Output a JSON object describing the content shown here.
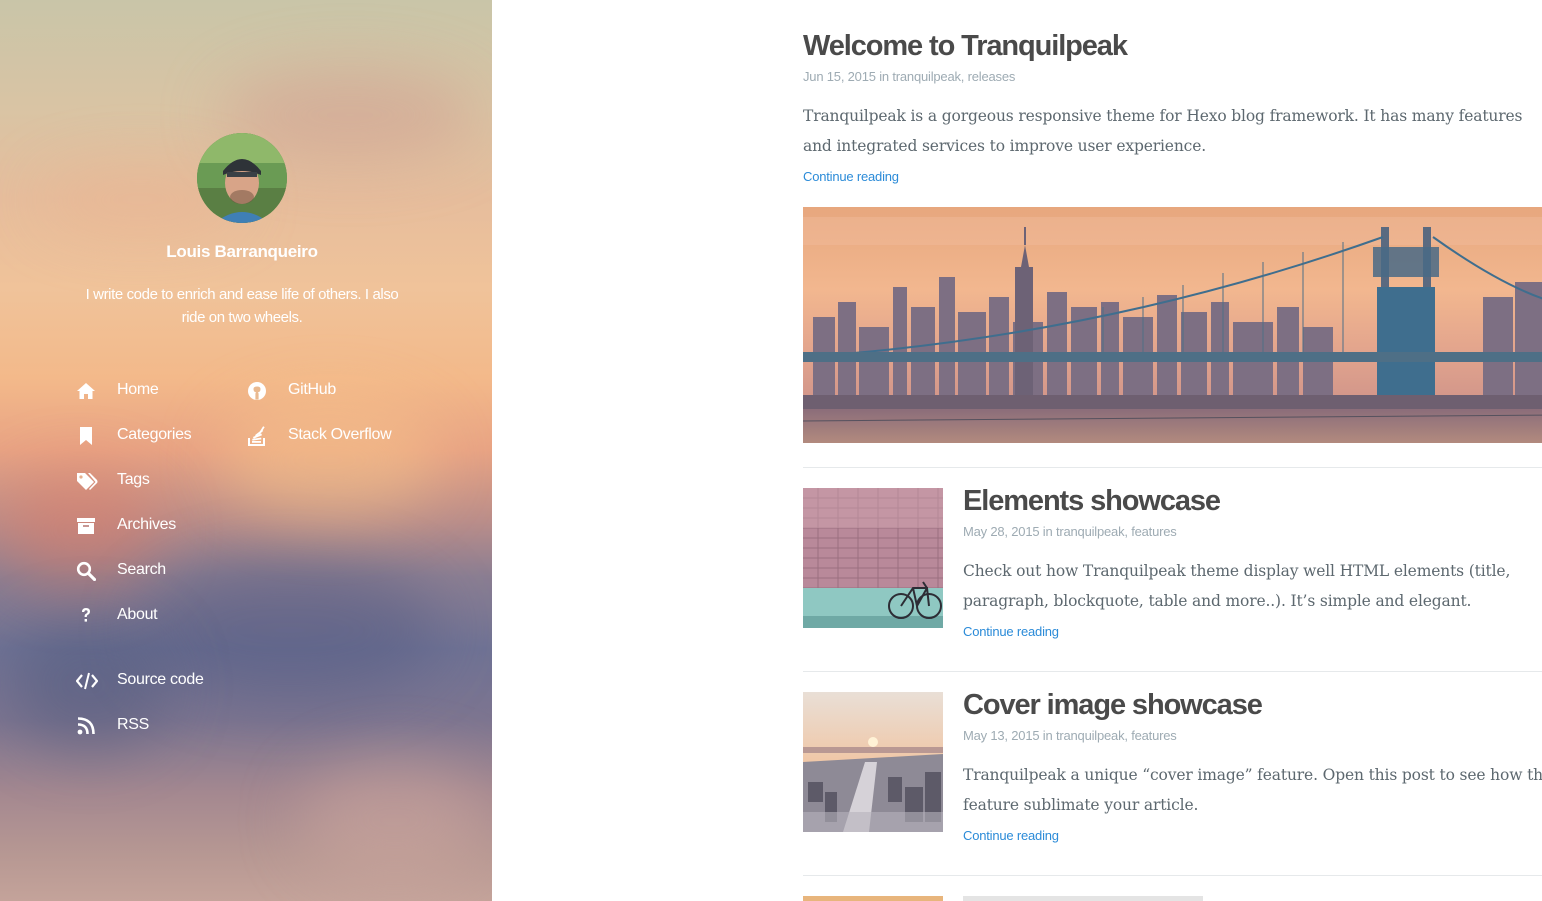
{
  "sidebar": {
    "profile": {
      "name": "Louis Barranqueiro",
      "bio": "I write code to enrich and ease life of others. I also ride on two wheels."
    },
    "menu": [
      {
        "label": "Home",
        "icon": "home-icon"
      },
      {
        "label": "Categories",
        "icon": "bookmark-icon"
      },
      {
        "label": "Tags",
        "icon": "tags-icon"
      },
      {
        "label": "Archives",
        "icon": "archive-icon"
      },
      {
        "label": "Search",
        "icon": "search-icon"
      },
      {
        "label": "About",
        "icon": "question-icon"
      }
    ],
    "social": [
      {
        "label": "GitHub",
        "icon": "github-icon"
      },
      {
        "label": "Stack Overflow",
        "icon": "stack-overflow-icon"
      }
    ],
    "links": [
      {
        "label": "Source code",
        "icon": "code-icon"
      },
      {
        "label": "RSS",
        "icon": "rss-icon"
      }
    ]
  },
  "posts": [
    {
      "title": "Welcome to Tranquilpeak",
      "date": "Jun 15, 2015",
      "in": "in",
      "categories": [
        "tranquilpeak",
        "releases"
      ],
      "excerpt": "Tranquilpeak is a gorgeous responsive theme for Hexo blog framework. It has many features and integrated services to improve user experience.",
      "continue": "Continue reading"
    },
    {
      "title": "Elements showcase",
      "date": "May 28, 2015",
      "in": "in",
      "categories": [
        "tranquilpeak",
        "features"
      ],
      "excerpt": "Check out how Tranquilpeak theme display well HTML elements (title, paragraph, blockquote, table and more..). It’s simple and elegant.",
      "continue": "Continue reading"
    },
    {
      "title": "Cover image showcase",
      "date": "May 13, 2015",
      "in": "in",
      "categories": [
        "tranquilpeak",
        "features"
      ],
      "excerpt": "Tranquilpeak a unique “cover image” feature. Open this post to see how this feature sublimate your article.",
      "continue": "Continue reading"
    }
  ],
  "colors": {
    "link": "#2b8bd8",
    "title": "#4a4a4a",
    "meta": "#9eabb3",
    "excerpt": "#5d686f"
  }
}
